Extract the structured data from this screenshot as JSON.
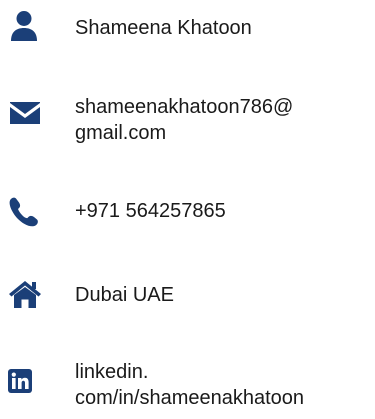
{
  "contact": {
    "name": "Shameena Khatoon",
    "email_line1": "shameenakhatoon786@",
    "email_line2": "gmail.com",
    "phone": "+971 564257865",
    "location": "Dubai UAE",
    "linkedin_line1": "linkedin.",
    "linkedin_line2": "com/in/shameenakhatoon"
  },
  "icons": {
    "name": "person-icon",
    "email": "envelope-icon",
    "phone": "phone-icon",
    "location": "home-icon",
    "linkedin": "linkedin-icon"
  },
  "colors": {
    "icon": "#1b3f78",
    "text": "#1a1a1a"
  }
}
